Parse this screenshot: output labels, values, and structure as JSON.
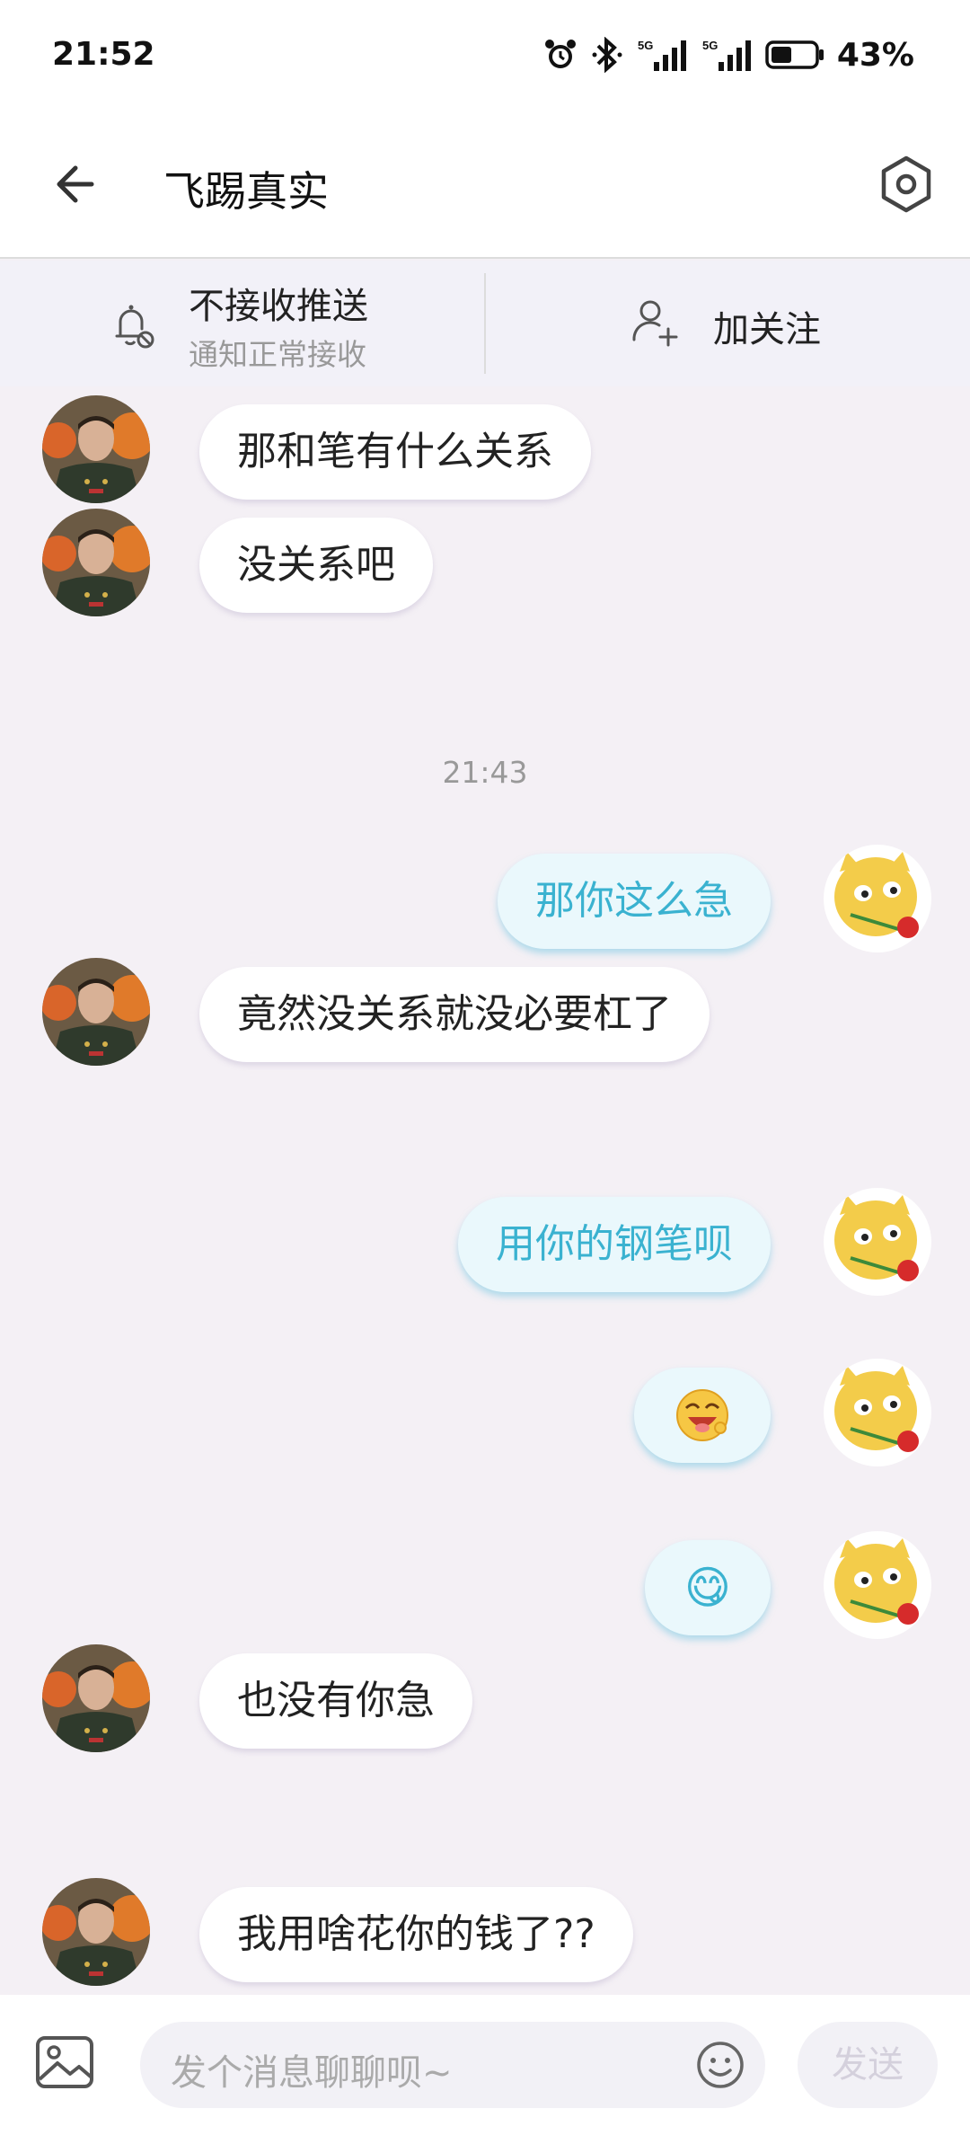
{
  "status_bar": {
    "time": "21:52",
    "battery": "43%",
    "icons": [
      "alarm-icon",
      "bluetooth-icon",
      "signal-5g-icon",
      "signal-5g-icon",
      "battery-icon"
    ]
  },
  "header": {
    "title": "飞踢真实",
    "back_icon": "back-arrow-icon",
    "settings_icon": "settings-hexagon-icon"
  },
  "notify": {
    "title": "不接收推送",
    "subtitle": "通知正常接收",
    "follow_label": "加关注"
  },
  "messages": [
    {
      "side": "left",
      "text": "那和笔有什么关系"
    },
    {
      "side": "left",
      "text": "没关系吧"
    },
    {
      "timestamp": "21:43"
    },
    {
      "side": "right",
      "text": "那你这么急"
    },
    {
      "side": "left",
      "text": "竟然没关系就没必要杠了"
    },
    {
      "side": "right",
      "text": "用你的钢笔呗"
    },
    {
      "side": "right",
      "text": "",
      "emoji": "grinning-sticker"
    },
    {
      "side": "right",
      "text": "😋"
    },
    {
      "side": "left",
      "text": "也没有你急"
    },
    {
      "side": "left",
      "text": "我用啥花你的钱了??"
    }
  ],
  "input": {
    "placeholder": "发个消息聊聊呗~",
    "send_label": "发送"
  },
  "colors": {
    "chat_background": "#f4f0f5",
    "sent_text": "#3ab2d0",
    "sent_bubble": "#eaf8fc"
  }
}
